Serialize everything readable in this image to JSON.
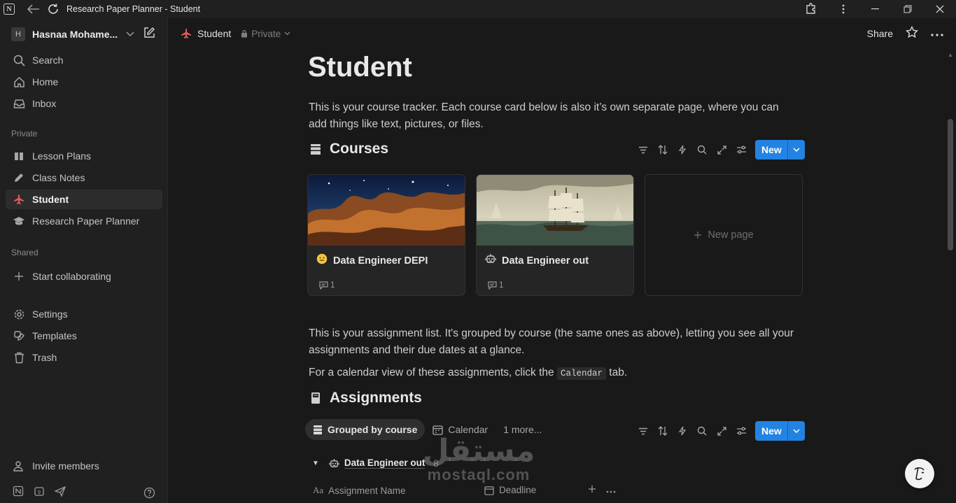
{
  "titlebar": {
    "window_title": "Research Paper Planner - Student"
  },
  "sidebar": {
    "workspace_initial": "H",
    "workspace_name": "Hasnaa Mohame...",
    "top_items": [
      {
        "label": "Search",
        "icon": "search-icon"
      },
      {
        "label": "Home",
        "icon": "home-icon"
      },
      {
        "label": "Inbox",
        "icon": "inbox-icon"
      }
    ],
    "private_heading": "Private",
    "private_items": [
      {
        "label": "Lesson Plans",
        "icon": "book-icon"
      },
      {
        "label": "Class Notes",
        "icon": "pencil-icon"
      },
      {
        "label": "Student",
        "icon": "airplane-icon",
        "active": true
      },
      {
        "label": "Research Paper Planner",
        "icon": "graduation-cap-icon"
      }
    ],
    "shared_heading": "Shared",
    "shared_items": [
      {
        "label": "Start collaborating",
        "icon": "plus-icon"
      }
    ],
    "util_items": [
      {
        "label": "Settings",
        "icon": "gear-icon"
      },
      {
        "label": "Templates",
        "icon": "templates-icon"
      },
      {
        "label": "Trash",
        "icon": "trash-icon"
      }
    ],
    "invite_label": "Invite members"
  },
  "pagebar": {
    "crumb": "Student",
    "privacy": "Private",
    "share": "Share"
  },
  "page": {
    "title": "Student",
    "intro": "This is your course tracker. Each course card below is also it’s own separate page, where you can add things like text, pictures, or files.",
    "courses": {
      "title": "Courses",
      "new_label": "New",
      "cards": [
        {
          "title": "Data Engineer DEPI",
          "icon": "smiley-emoji-icon",
          "comments": "1"
        },
        {
          "title": "Data Engineer out",
          "icon": "robot-icon",
          "comments": "1"
        }
      ],
      "new_page": "New page"
    },
    "assign_intro": "This is your assignment list. It's grouped by course (the same ones as above), letting you see all your assignments and their due dates at a glance.",
    "calendar_hint_before": "For a calendar view of these assignments, click the",
    "calendar_hint_code": "Calendar",
    "calendar_hint_after": "tab.",
    "assignments": {
      "title": "Assignments",
      "new_label": "New",
      "views": [
        {
          "label": "Grouped by course",
          "active": true
        },
        {
          "label": "Calendar"
        },
        {
          "label": "1 more..."
        }
      ],
      "group": {
        "label": "Data Engineer out",
        "count": "8"
      },
      "columns": [
        {
          "label": "Assignment Name",
          "icon": "text-property-icon"
        },
        {
          "label": "Deadline",
          "icon": "calendar-icon"
        }
      ]
    }
  },
  "watermark": {
    "arabic": "مستقل",
    "latin": "mostaql.com"
  },
  "colors": {
    "accent": "#2383e2",
    "brand_icon": "#e35d5b",
    "background": "#191919",
    "sidebar": "#202020"
  }
}
